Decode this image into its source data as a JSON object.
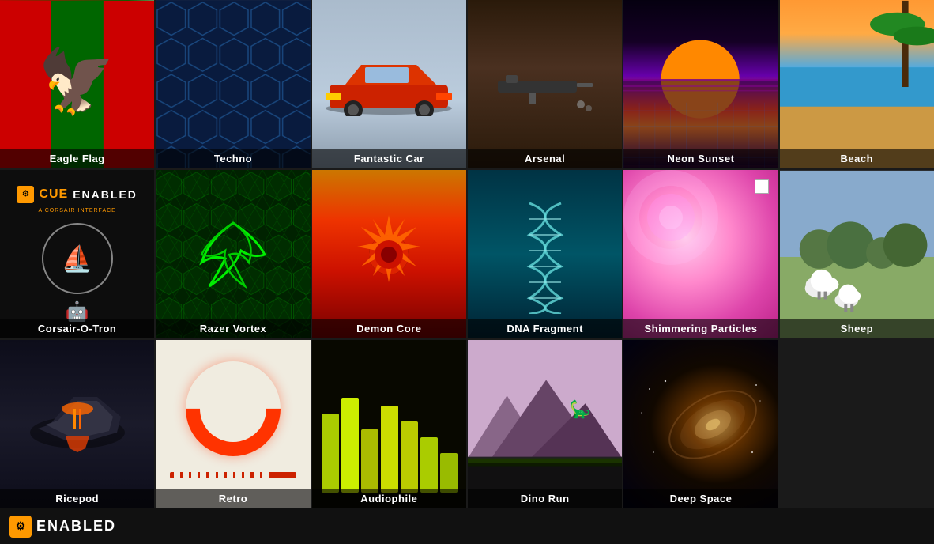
{
  "grid": {
    "cells": [
      {
        "id": "eagle-flag",
        "label": "Eagle Flag",
        "row": 1,
        "col": 1
      },
      {
        "id": "techno",
        "label": "Techno",
        "row": 1,
        "col": 2
      },
      {
        "id": "fantastic-car",
        "label": "Fantastic Car",
        "row": 1,
        "col": 3
      },
      {
        "id": "arsenal",
        "label": "Arsenal",
        "row": 1,
        "col": 4
      },
      {
        "id": "neon-sunset",
        "label": "Neon Sunset",
        "row": 1,
        "col": 5
      },
      {
        "id": "beach",
        "label": "Beach",
        "row": 1,
        "col": 6
      },
      {
        "id": "corsair",
        "label": "Corsair-O-Tron",
        "row": 2,
        "col": 1
      },
      {
        "id": "razer",
        "label": "Razer Vortex",
        "row": 2,
        "col": 2
      },
      {
        "id": "demon-core",
        "label": "Demon Core",
        "row": 2,
        "col": 3
      },
      {
        "id": "dna",
        "label": "DNA Fragment",
        "row": 2,
        "col": 4
      },
      {
        "id": "shimmering",
        "label": "Shimmering Particles",
        "row": 2,
        "col": 5
      },
      {
        "id": "sheep",
        "label": "Sheep",
        "row": 3,
        "col": 1
      },
      {
        "id": "ricepod",
        "label": "Ricepod",
        "row": 3,
        "col": 2
      },
      {
        "id": "retro",
        "label": "Retro",
        "row": 3,
        "col": 3
      },
      {
        "id": "audiophile",
        "label": "Audiophile",
        "row": 3,
        "col": 4
      },
      {
        "id": "dino-run",
        "label": "Dino Run",
        "row": 3,
        "col": 5
      },
      {
        "id": "deep-space",
        "label": "Deep Space",
        "row": 3,
        "col": 6
      }
    ]
  },
  "bottom_bar": {
    "enabled_label": "ENABLED",
    "icon_symbol": "⚙"
  },
  "cue": {
    "title": "CUE",
    "subtitle": "A CORSAIR INTERFACE",
    "enabled_label": "ENABLED"
  }
}
